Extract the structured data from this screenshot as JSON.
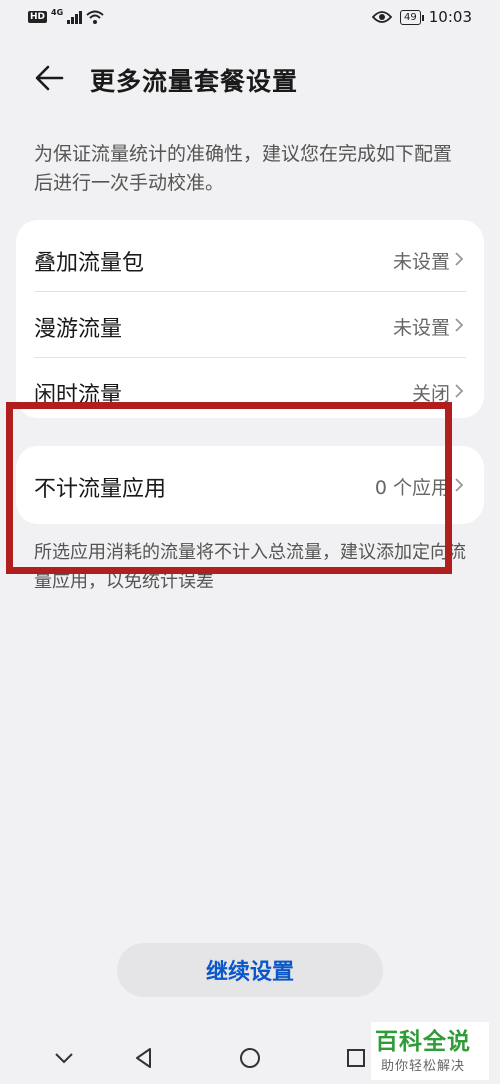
{
  "status_bar": {
    "hd": "HD",
    "network": "4G",
    "battery": "49",
    "time": "10:03"
  },
  "header": {
    "title": "更多流量套餐设置"
  },
  "description": "为保证流量统计的准确性，建议您在完成如下配置后进行一次手动校准。",
  "settings": [
    {
      "label": "叠加流量包",
      "value": "未设置"
    },
    {
      "label": "漫游流量",
      "value": "未设置"
    },
    {
      "label": "闲时流量",
      "value": "关闭"
    }
  ],
  "exempt_apps": {
    "label": "不计流量应用",
    "value": "0 个应用"
  },
  "exempt_note": "所选应用消耗的流量将不计入总流量，建议添加定向流量应用，以免统计误差",
  "continue_label": "继续设置",
  "watermark": {
    "title": "百科全说",
    "subtitle": "助你轻松解决"
  },
  "colors": {
    "accent": "#0b57c9",
    "highlight": "#b01e1e",
    "background": "#f1f1f3"
  }
}
